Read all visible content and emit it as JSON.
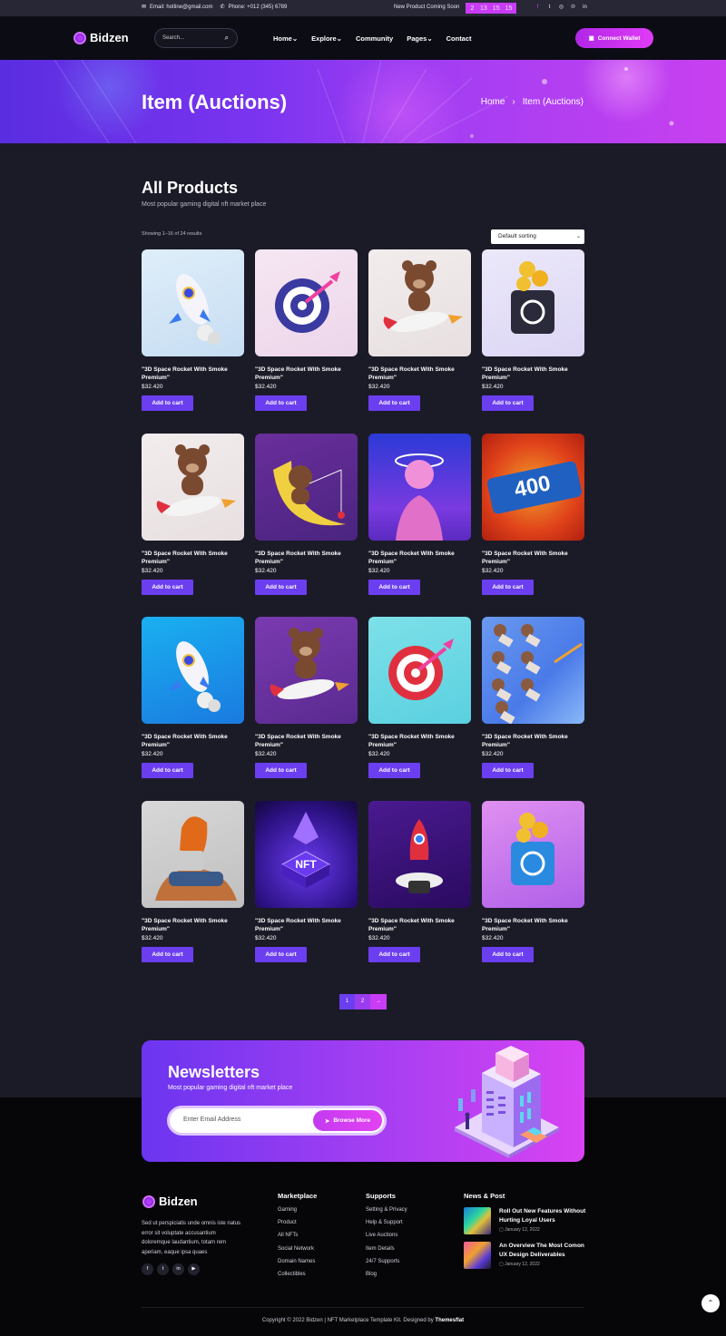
{
  "topbar": {
    "email": "Email: hotline@gmail.com",
    "phone": "Phone: +012 (345) 6789",
    "coming_soon": "New Product Coming Soon",
    "countdown": [
      "2",
      "13",
      "15",
      "15"
    ],
    "social_icons": [
      "facebook-icon",
      "twitter-icon",
      "instagram-icon",
      "pinterest-icon",
      "linkedin-icon"
    ]
  },
  "header": {
    "logo": "Bidzen",
    "search_placeholder": "Search...",
    "nav": [
      "Home",
      "Explore",
      "Community",
      "Pages",
      "Contact"
    ],
    "nav_dropdown": [
      true,
      true,
      false,
      true,
      false
    ],
    "connect_label": "Connect Wallet"
  },
  "hero": {
    "title": "Item (Auctions)",
    "breadcrumb": [
      "Home",
      "Item (Auctions)"
    ],
    "breadcrumb_sep": "›"
  },
  "products": {
    "title": "All Products",
    "subtitle": "Most popular gaming digital nft market place",
    "showing": "Showing 1–16 of 24 results",
    "sorting": "Default sorting",
    "items": [
      {
        "name": "\"3D Space Rocket With Smoke Premium\"",
        "price": "$32.420",
        "cta": "Add to cart",
        "art": "rocket"
      },
      {
        "name": "\"3D Space Rocket With Smoke Premium\"",
        "price": "$32.420",
        "cta": "Add to cart",
        "art": "target-dart"
      },
      {
        "name": "\"3D Space Rocket With Smoke Premium\"",
        "price": "$32.420",
        "cta": "Add to cart",
        "art": "bear-rocket"
      },
      {
        "name": "\"3D Space Rocket With Smoke Premium\"",
        "price": "$32.420",
        "cta": "Add to cart",
        "art": "safe-coins"
      },
      {
        "name": "\"3D Space Rocket With Smoke Premium\"",
        "price": "$32.420",
        "cta": "Add to cart",
        "art": "bear-rocket"
      },
      {
        "name": "\"3D Space Rocket With Smoke Premium\"",
        "price": "$32.420",
        "cta": "Add to cart",
        "art": "bear-moon"
      },
      {
        "name": "\"3D Space Rocket With Smoke Premium\"",
        "price": "$32.420",
        "cta": "Add to cart",
        "art": "statue"
      },
      {
        "name": "\"3D Space Rocket With Smoke Premium\"",
        "price": "$32.420",
        "cta": "Add to cart",
        "art": "400mb"
      },
      {
        "name": "\"3D Space Rocket With Smoke Premium\"",
        "price": "$32.420",
        "cta": "Add to cart",
        "art": "rocket-blue"
      },
      {
        "name": "\"3D Space Rocket With Smoke Premium\"",
        "price": "$32.420",
        "cta": "Add to cart",
        "art": "bear-rocket-purple"
      },
      {
        "name": "\"3D Space Rocket With Smoke Premium\"",
        "price": "$32.420",
        "cta": "Add to cart",
        "art": "target-hand"
      },
      {
        "name": "\"3D Space Rocket With Smoke Premium\"",
        "price": "$32.420",
        "cta": "Add to cart",
        "art": "hands"
      },
      {
        "name": "\"3D Space Rocket With Smoke Premium\"",
        "price": "$32.420",
        "cta": "Add to cart",
        "art": "girl-laptop"
      },
      {
        "name": "\"3D Space Rocket With Smoke Premium\"",
        "price": "$32.420",
        "cta": "Add to cart",
        "art": "nft-ethereum"
      },
      {
        "name": "\"3D Space Rocket With Smoke Premium\"",
        "price": "$32.420",
        "cta": "Add to cart",
        "art": "rocket-launch"
      },
      {
        "name": "\"3D Space Rocket With Smoke Premium\"",
        "price": "$32.420",
        "cta": "Add to cart",
        "art": "safe-pink"
      }
    ]
  },
  "pagination": [
    "1",
    "2",
    "→"
  ],
  "newsletter": {
    "title": "Newsletters",
    "subtitle": "Most popular gaming digital nft market place",
    "placeholder": "Enter Email Address",
    "button": "Browse More"
  },
  "footer": {
    "logo": "Bidzen",
    "about": "Sed ut perspiciatis unde omnis iste natus error sit voluptate accusantium doloremque laudantium, totam rem aperiam, eaque ipsa quaes",
    "social_icons": [
      "facebook-icon",
      "twitter-icon",
      "linkedin-icon",
      "youtube-icon"
    ],
    "marketplace": {
      "title": "Marketplace",
      "links": [
        "Gaming",
        "Product",
        "All NFTs",
        "Social Network",
        "Domain Names",
        "Collectibles"
      ]
    },
    "supports": {
      "title": "Supports",
      "links": [
        "Setting & Privacy",
        "Help & Support",
        "Live Auctions",
        "Item Details",
        "24/7 Supports",
        "Blog"
      ]
    },
    "news": {
      "title": "News & Post",
      "posts": [
        {
          "title": "Roll Out New Features Without Hurting Loyal Users",
          "date": "January 12, 2022"
        },
        {
          "title": "An Overview The Most Comon UX Design Deliverables",
          "date": "January 12, 2022"
        }
      ]
    },
    "copyright_pre": "Copyright © 2022 Bidzen | NFT Marketplace Template Kit. Designed by",
    "copyright_brand": "Themesflat"
  },
  "colors": {
    "accent": "#6b3ef0",
    "magenta": "#c93cf5",
    "bg": "#1b1b28"
  }
}
